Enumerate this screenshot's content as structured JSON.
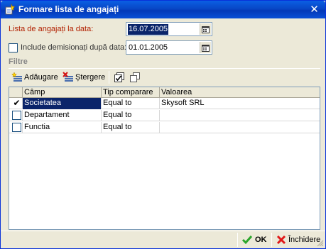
{
  "window": {
    "title": "Formare lista de angajați",
    "close_glyph": "✕"
  },
  "form": {
    "list_date_label": "Lista de angajați la data:",
    "list_date_value": "16.07.2005",
    "include_dismissed_label": "Include demisionați după data:",
    "include_dismissed_checked": false,
    "dismissed_date_value": "01.01.2005"
  },
  "filters": {
    "section_title": "Filtre",
    "add_label": "Adăugare",
    "delete_label": "Ștergere",
    "columns": [
      "Câmp",
      "Tip comparare",
      "Valoarea"
    ],
    "rows": [
      {
        "checked": true,
        "field": "Societatea",
        "comparison": "Equal to",
        "value": "Skysoft SRL",
        "selected": true
      },
      {
        "checked": false,
        "field": "Departament",
        "comparison": "Equal to",
        "value": "",
        "selected": false
      },
      {
        "checked": false,
        "field": "Functia",
        "comparison": "Equal to",
        "value": "",
        "selected": false
      }
    ]
  },
  "footer": {
    "ok_label": "OK",
    "close_label": "Închidere"
  },
  "icons": {
    "app": "app-icon",
    "calendar": "calendar-icon",
    "add": "add-filter-icon",
    "delete": "delete-filter-icon",
    "check_all": "check-all-icon",
    "copy": "copy-icon",
    "ok": "green-check-icon",
    "close": "red-x-icon"
  },
  "colors": {
    "title_bar": "#0847c6",
    "label_red": "#b22000",
    "selection": "#0a246a"
  }
}
